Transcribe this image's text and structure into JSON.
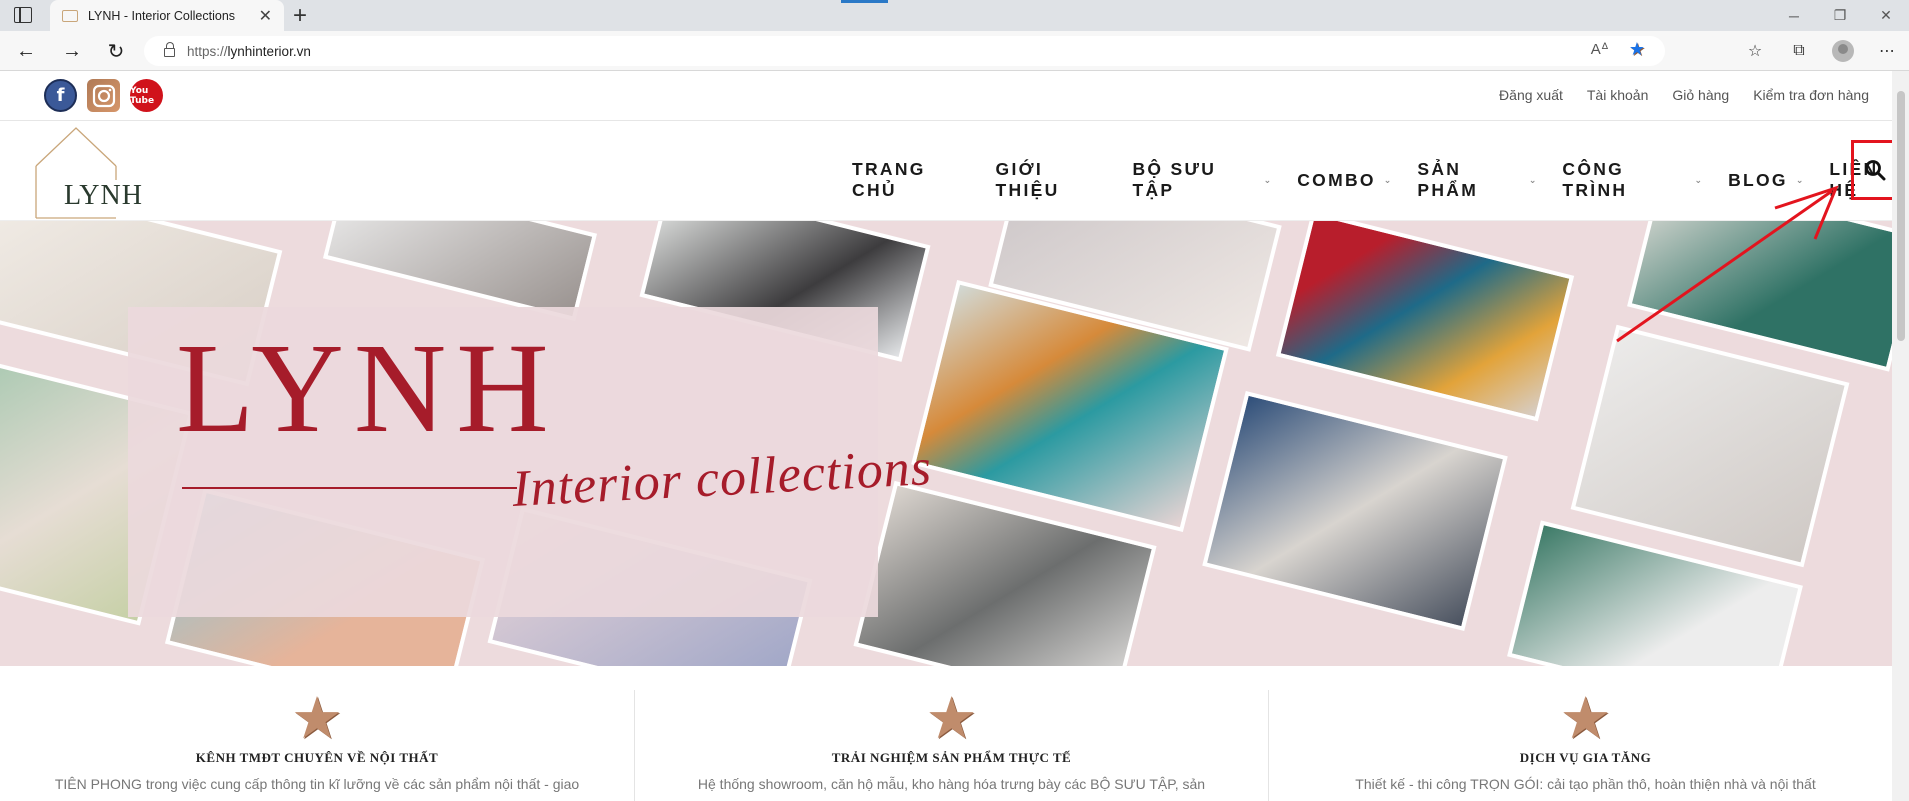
{
  "browser": {
    "tab_title": "LYNH - Interior Collections",
    "url_protocol": "https://",
    "url_host": "lynhinterior.vn"
  },
  "icons": {
    "sidebar_toggle": "tab-actions-icon",
    "close": "close-icon",
    "new_tab": "plus-icon",
    "back": "back-arrow-icon",
    "forward": "forward-arrow-icon",
    "reload": "reload-icon",
    "lock": "lock-icon",
    "read_aloud": "read-aloud-icon",
    "favorite": "star-icon",
    "favorites": "favorites-icon",
    "collections": "collections-icon",
    "profile": "profile-icon",
    "menu": "more-icon",
    "search": "search-icon",
    "feature": "star-icon"
  },
  "social": {
    "facebook": "f",
    "instagram": "",
    "youtube": "You Tube"
  },
  "account_links": [
    "Đăng xuất",
    "Tài khoản",
    "Giỏ hàng",
    "Kiểm tra đơn hàng"
  ],
  "logo": {
    "text": "LYNH"
  },
  "nav": [
    {
      "label": "TRANG CHỦ",
      "dropdown": false
    },
    {
      "label": "GIỚI THIỆU",
      "dropdown": false
    },
    {
      "label": "BỘ SƯU TẬP",
      "dropdown": true
    },
    {
      "label": "COMBO",
      "dropdown": true
    },
    {
      "label": "SẢN PHẨM",
      "dropdown": true
    },
    {
      "label": "CÔNG TRÌNH",
      "dropdown": true
    },
    {
      "label": "BLOG",
      "dropdown": true
    },
    {
      "label": "LIÊN HỆ",
      "dropdown": false
    }
  ],
  "hero": {
    "title": "LYNH",
    "subtitle": "Interior collections"
  },
  "features": [
    {
      "title": "KÊNH TMĐT CHUYÊN VỀ NỘI THẤT",
      "text": "TIÊN PHONG trong việc cung cấp thông tin kĩ lưỡng về các sản phẩm nội thất - giao"
    },
    {
      "title": "TRẢI NGHIỆM SẢN PHẨM THỰC TẾ",
      "text": "Hệ thống showroom, căn hộ mẫu, kho hàng hóa trưng bày các BỘ SƯU TẬP, sản"
    },
    {
      "title": "DỊCH VỤ GIA TĂNG",
      "text": "Thiết kế - thi công TRỌN GÓI: cải tạo phần thô, hoàn thiện nhà và nội thất"
    }
  ],
  "colors": {
    "brand_red": "#a61c2a",
    "annotation_red": "#e3141e",
    "hero_bg": "#eddbdd",
    "star_bronze": "#c08c6c"
  }
}
